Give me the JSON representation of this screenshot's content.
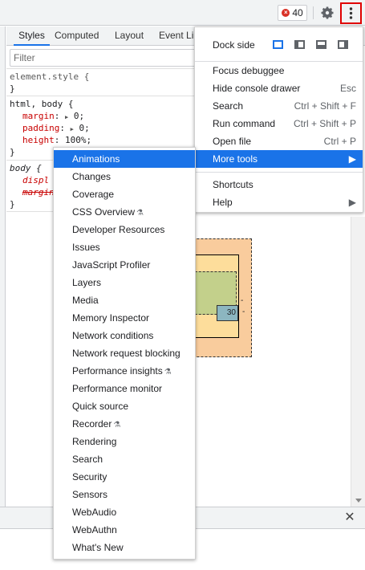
{
  "toolbar": {
    "error_count": "40",
    "icons": [
      "error-icon",
      "gear-icon",
      "more-vert-icon"
    ]
  },
  "styles_tabs": [
    "Styles",
    "Computed",
    "Layout",
    "Event Li"
  ],
  "filter": {
    "placeholder": "Filter"
  },
  "rules": {
    "element_style": {
      "selector": "element.style {",
      "close": "}"
    },
    "html_body": {
      "selector": "html, body {",
      "props": [
        {
          "name": "margin",
          "value": "0;"
        },
        {
          "name": "padding",
          "value": "0;"
        },
        {
          "name": "height",
          "value": "100%;"
        }
      ],
      "close": "}"
    },
    "body": {
      "selector": "body {",
      "props": [
        {
          "name": "displ",
          "value": ""
        },
        {
          "name": "margin",
          "value": ""
        }
      ],
      "close": "}"
    }
  },
  "box_model": {
    "content_value": "30",
    "right_dash_1": "-",
    "right_dash_2": "-"
  },
  "main_menu": {
    "dock_side": "Dock side",
    "items": [
      {
        "label": "Focus debuggee",
        "shortcut": ""
      },
      {
        "label": "Hide console drawer",
        "shortcut": "Esc"
      },
      {
        "label": "Search",
        "shortcut": "Ctrl + Shift + F"
      },
      {
        "label": "Run command",
        "shortcut": "Ctrl + Shift + P"
      },
      {
        "label": "Open file",
        "shortcut": "Ctrl + P"
      },
      {
        "label": "More tools",
        "shortcut": "▶"
      }
    ],
    "bottom_items": [
      {
        "label": "Shortcuts",
        "shortcut": ""
      },
      {
        "label": "Help",
        "shortcut": "▶"
      }
    ]
  },
  "more_tools": [
    {
      "label": "Animations",
      "experimental": false
    },
    {
      "label": "Changes",
      "experimental": false
    },
    {
      "label": "Coverage",
      "experimental": false
    },
    {
      "label": "CSS Overview",
      "experimental": true
    },
    {
      "label": "Developer Resources",
      "experimental": false
    },
    {
      "label": "Issues",
      "experimental": false
    },
    {
      "label": "JavaScript Profiler",
      "experimental": false
    },
    {
      "label": "Layers",
      "experimental": false
    },
    {
      "label": "Media",
      "experimental": false
    },
    {
      "label": "Memory Inspector",
      "experimental": false
    },
    {
      "label": "Network conditions",
      "experimental": false
    },
    {
      "label": "Network request blocking",
      "experimental": false
    },
    {
      "label": "Performance insights",
      "experimental": true
    },
    {
      "label": "Performance monitor",
      "experimental": false
    },
    {
      "label": "Quick source",
      "experimental": false
    },
    {
      "label": "Recorder",
      "experimental": true
    },
    {
      "label": "Rendering",
      "experimental": false
    },
    {
      "label": "Search",
      "experimental": false
    },
    {
      "label": "Security",
      "experimental": false
    },
    {
      "label": "Sensors",
      "experimental": false
    },
    {
      "label": "WebAudio",
      "experimental": false
    },
    {
      "label": "WebAuthn",
      "experimental": false
    },
    {
      "label": "What's New",
      "experimental": false
    }
  ],
  "colors": {
    "highlight": "#1a73e8",
    "error": "#d93025",
    "kebab_outline": "#e00000"
  }
}
